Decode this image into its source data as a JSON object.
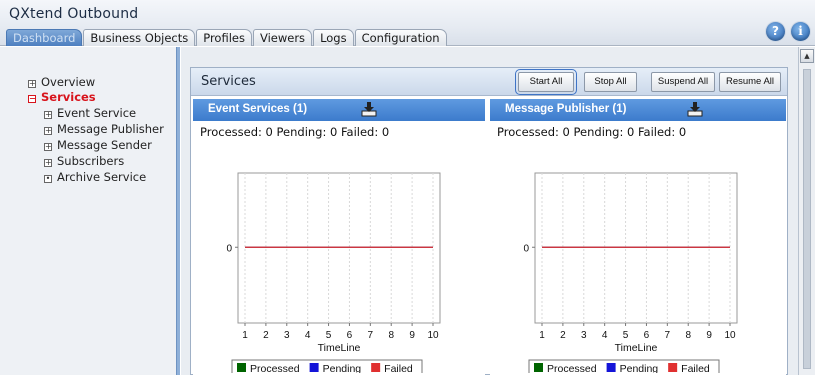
{
  "app": {
    "title": "QXtend Outbound",
    "tabs": [
      {
        "label": "Dashboard",
        "active": true
      },
      {
        "label": "Business Objects",
        "active": false
      },
      {
        "label": "Profiles",
        "active": false
      },
      {
        "label": "Viewers",
        "active": false
      },
      {
        "label": "Logs",
        "active": false
      },
      {
        "label": "Configuration",
        "active": false
      }
    ],
    "help_icon": "help-icon",
    "info_icon": "info-icon"
  },
  "nav": {
    "items": [
      {
        "label": "Overview",
        "level": 0,
        "selected": false
      },
      {
        "label": "Services",
        "level": 0,
        "selected": true
      },
      {
        "label": "Event Service",
        "level": 1,
        "selected": false
      },
      {
        "label": "Message Publisher",
        "level": 1,
        "selected": false
      },
      {
        "label": "Message Sender",
        "level": 1,
        "selected": false
      },
      {
        "label": "Subscribers",
        "level": 1,
        "selected": false
      },
      {
        "label": "Archive Service",
        "level": 1,
        "selected": false
      }
    ]
  },
  "main": {
    "title": "Services",
    "buttons": {
      "start_all": "Start All",
      "stop_all": "Stop All",
      "suspend_all": "Suspend All",
      "resume_all": "Resume All"
    },
    "panels": [
      {
        "title": "Event Services (1)",
        "stats": "Processed: 0   Pending: 0   Failed: 0"
      },
      {
        "title": "Message Publisher (1)",
        "stats": "Processed: 0   Pending: 0   Failed: 0"
      }
    ]
  },
  "chart_data": [
    {
      "type": "line",
      "xlabel": "TimeLine",
      "ylabel": "",
      "x": [
        1,
        2,
        3,
        4,
        5,
        6,
        7,
        8,
        9,
        10
      ],
      "yticks": [
        0
      ],
      "series": [
        {
          "name": "Processed",
          "color": "#006400",
          "values": [
            0,
            0,
            0,
            0,
            0,
            0,
            0,
            0,
            0,
            0
          ]
        },
        {
          "name": "Pending",
          "color": "#1414d8",
          "values": [
            0,
            0,
            0,
            0,
            0,
            0,
            0,
            0,
            0,
            0
          ]
        },
        {
          "name": "Failed",
          "color": "#e03030",
          "values": [
            0,
            0,
            0,
            0,
            0,
            0,
            0,
            0,
            0,
            0
          ]
        }
      ],
      "legend_position": "bottom",
      "grid": "vertical"
    },
    {
      "type": "line",
      "xlabel": "TimeLine",
      "ylabel": "",
      "x": [
        1,
        2,
        3,
        4,
        5,
        6,
        7,
        8,
        9,
        10
      ],
      "yticks": [
        0
      ],
      "series": [
        {
          "name": "Processed",
          "color": "#006400",
          "values": [
            0,
            0,
            0,
            0,
            0,
            0,
            0,
            0,
            0,
            0
          ]
        },
        {
          "name": "Pending",
          "color": "#1414d8",
          "values": [
            0,
            0,
            0,
            0,
            0,
            0,
            0,
            0,
            0,
            0
          ]
        },
        {
          "name": "Failed",
          "color": "#e03030",
          "values": [
            0,
            0,
            0,
            0,
            0,
            0,
            0,
            0,
            0,
            0
          ]
        }
      ],
      "legend_position": "bottom",
      "grid": "vertical"
    }
  ]
}
